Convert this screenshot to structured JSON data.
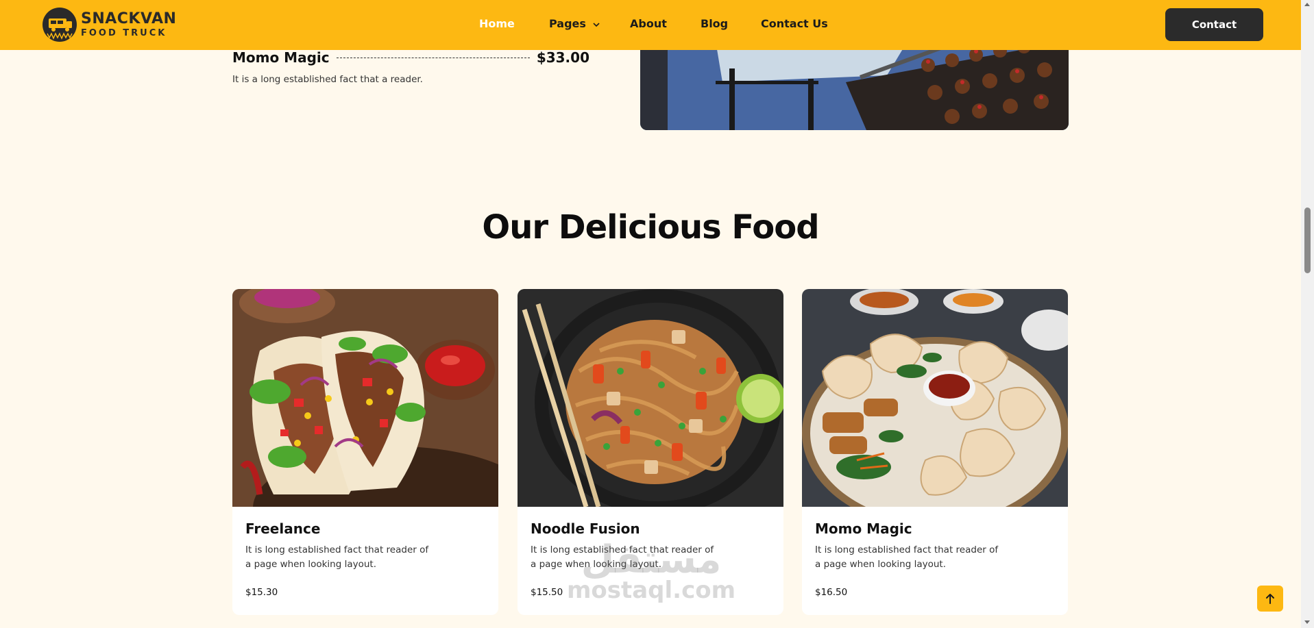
{
  "brand": {
    "name": "SNACKVAN",
    "tagline": "FOOD TRUCK"
  },
  "nav": {
    "items": [
      {
        "label": "Home",
        "active": true
      },
      {
        "label": "Pages",
        "has_dropdown": true
      },
      {
        "label": "About"
      },
      {
        "label": "Blog"
      },
      {
        "label": "Contact Us"
      }
    ],
    "cta": "Contact"
  },
  "menu_item": {
    "name": "Momo Magic",
    "price": "$33.00",
    "description": "It is a long established fact that a reader."
  },
  "section": {
    "title": "Our Delicious Food"
  },
  "cards": [
    {
      "title": "Freelance",
      "description": "It is long established fact that reader of a page when looking layout.",
      "price": "$15.30",
      "image": "tacos"
    },
    {
      "title": "Noodle Fusion",
      "description": "It is long established fact that reader of a page when looking layout.",
      "price": "$15.50",
      "image": "noodles"
    },
    {
      "title": "Momo Magic",
      "description": "It is long established fact that reader of a page when looking layout.",
      "price": "$16.50",
      "image": "momos"
    }
  ],
  "watermark": {
    "arabic": "مستقل",
    "latin": "mostaql.com"
  },
  "colors": {
    "accent": "#FDB812",
    "page_background": "#FFF9ED",
    "dark_button": "#2B2B2B"
  },
  "icons": [
    "food-truck-logo",
    "chevron-down-icon",
    "arrow-up-icon"
  ]
}
